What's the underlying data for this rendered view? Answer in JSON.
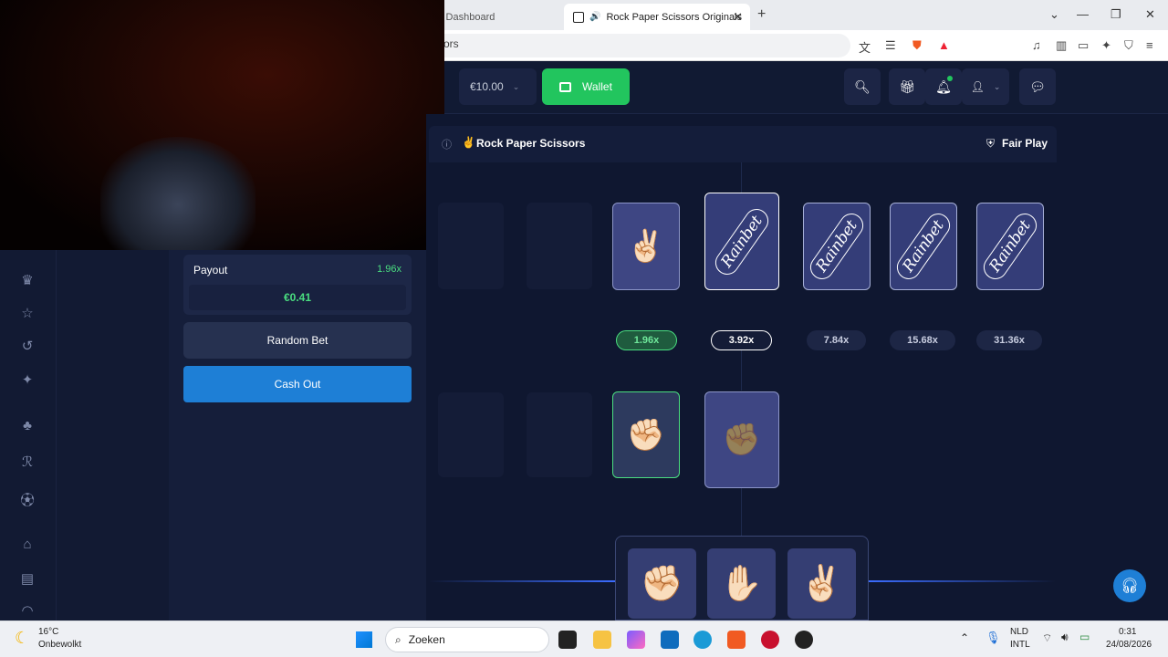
{
  "browser": {
    "tabs": [
      {
        "label": "k Dashboard",
        "active": false
      },
      {
        "label": "Rock Paper Scissors Originals",
        "active": true
      }
    ],
    "url": "sors"
  },
  "header": {
    "balance": "€10.00",
    "wallet_label": "Wallet"
  },
  "controls": {
    "payout_label": "Payout",
    "payout_multiplier": "1.96x",
    "payout_amount": "€0.41",
    "random_bet_label": "Random Bet",
    "cash_out_label": "Cash Out"
  },
  "game": {
    "title": "Rock Paper Scissors",
    "fair_play_label": "Fair Play",
    "house_cards": [
      {
        "type": "scissors",
        "revealed": true
      },
      {
        "type": "brand",
        "text": "Rainbet",
        "current": true
      },
      {
        "type": "brand",
        "text": "Rainbet"
      },
      {
        "type": "brand",
        "text": "Rainbet"
      },
      {
        "type": "brand",
        "text": "Rainbet"
      }
    ],
    "multipliers": [
      {
        "label": "1.96x",
        "state": "won"
      },
      {
        "label": "3.92x",
        "state": "current"
      },
      {
        "label": "7.84x",
        "state": "locked"
      },
      {
        "label": "15.68x",
        "state": "locked"
      },
      {
        "label": "31.36x",
        "state": "locked"
      }
    ],
    "player_cards": [
      {
        "type": "rock",
        "state": "won"
      },
      {
        "type": "rock",
        "state": "pending"
      }
    ],
    "choices": [
      {
        "type": "rock",
        "icon": "fist"
      },
      {
        "type": "paper",
        "icon": "raised-hand"
      },
      {
        "type": "scissors",
        "icon": "victory-hand"
      }
    ]
  },
  "taskbar": {
    "temperature": "16°C",
    "weather_desc": "Onbewolkt",
    "search_placeholder": "Zoeken",
    "lang_1": "NLD",
    "lang_2": "INTL",
    "time": "0:31",
    "date": "24/08/2026"
  },
  "colors": {
    "accent_green": "#22c55e",
    "accent_blue": "#1e7fd6",
    "background": "#0f1730"
  }
}
